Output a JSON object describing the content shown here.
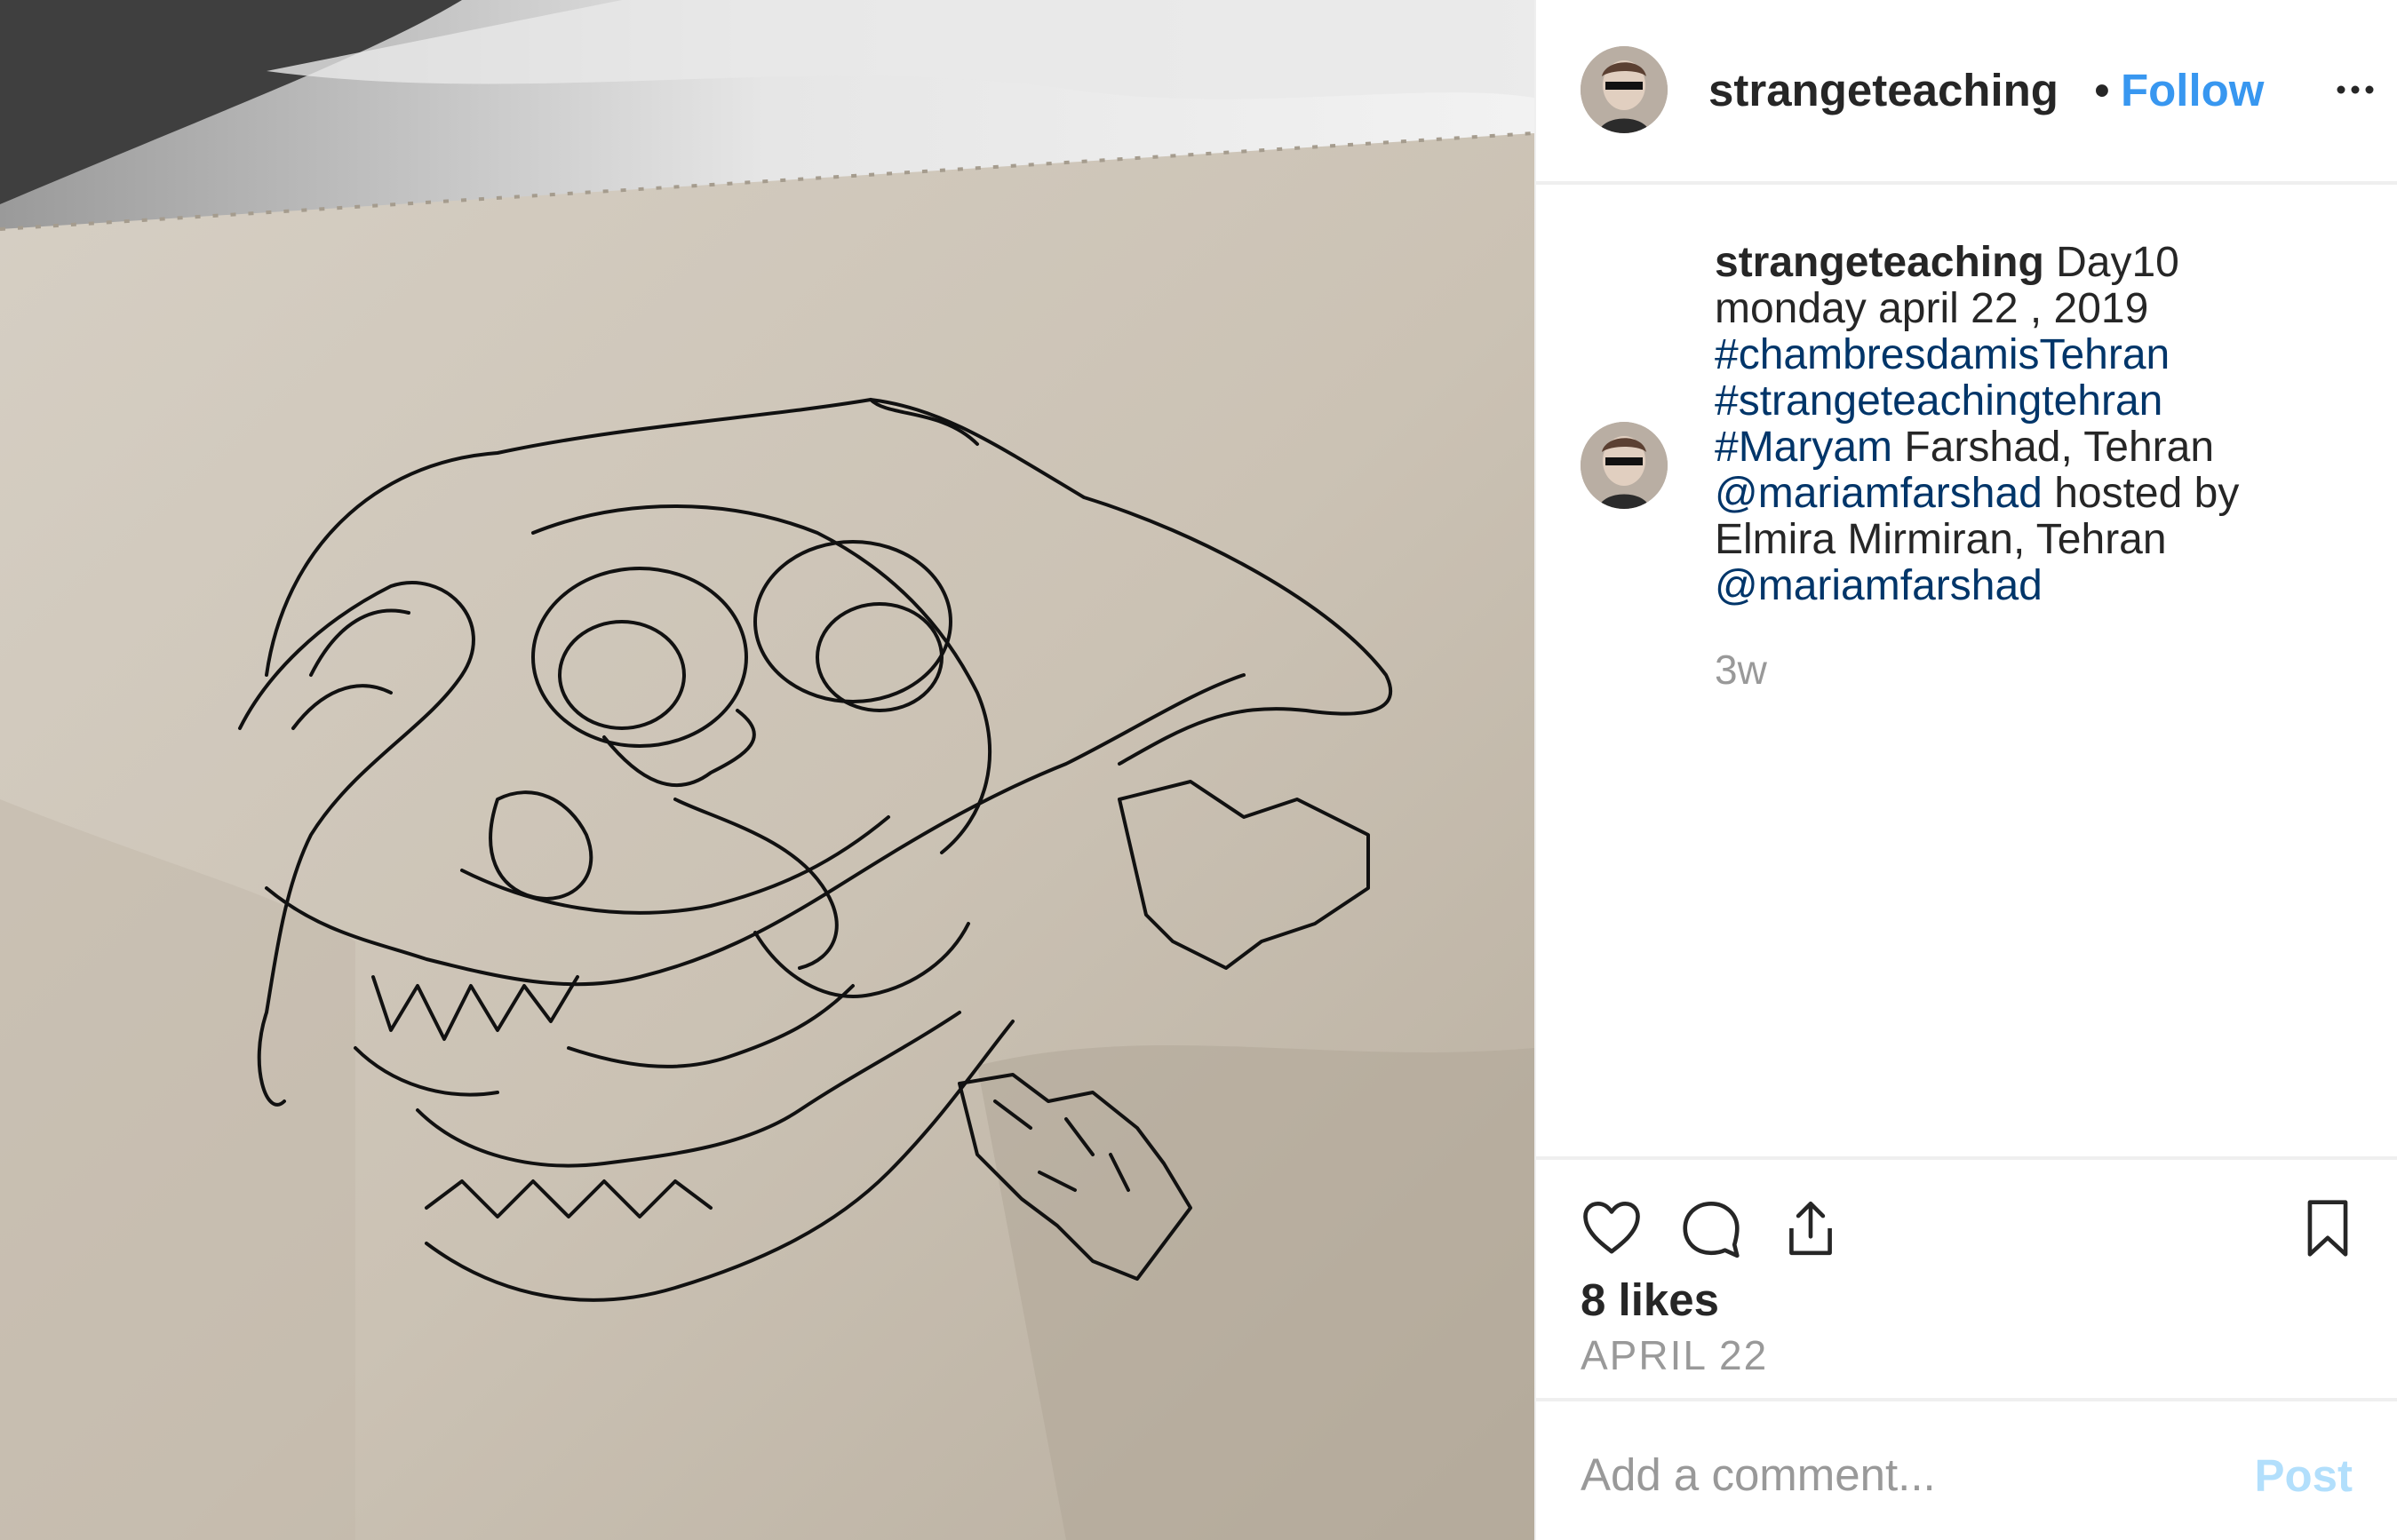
{
  "post": {
    "photo": {
      "subject": "ink-drawing-skull"
    },
    "header": {
      "username": "strangeteaching",
      "separator": "•",
      "follow_label": "Follow",
      "more_icon": "more-options-icon"
    },
    "caption": {
      "username": "strangeteaching",
      "line1": "Day10",
      "line2": "monday april 22 , 2019",
      "hashtag1": "#chambresdamisTehran",
      "hashtag2": "#strangeteachingtehran",
      "hashtag3": "#Maryam",
      "text3": "Farshad, Tehran",
      "mention1": "@mariamfarshad",
      "text4": "hosted by",
      "line6": "Elmira Mirmiran, Tehran",
      "mention2": "@mariamfarshad",
      "time_ago": "3w"
    },
    "actions": {
      "like_icon": "heart-icon",
      "comment_icon": "comment-icon",
      "share_icon": "share-icon",
      "save_icon": "bookmark-icon"
    },
    "likes": "8 likes",
    "date": "APRIL 22",
    "comment": {
      "placeholder": "Add a comment...",
      "post_label": "Post"
    }
  }
}
